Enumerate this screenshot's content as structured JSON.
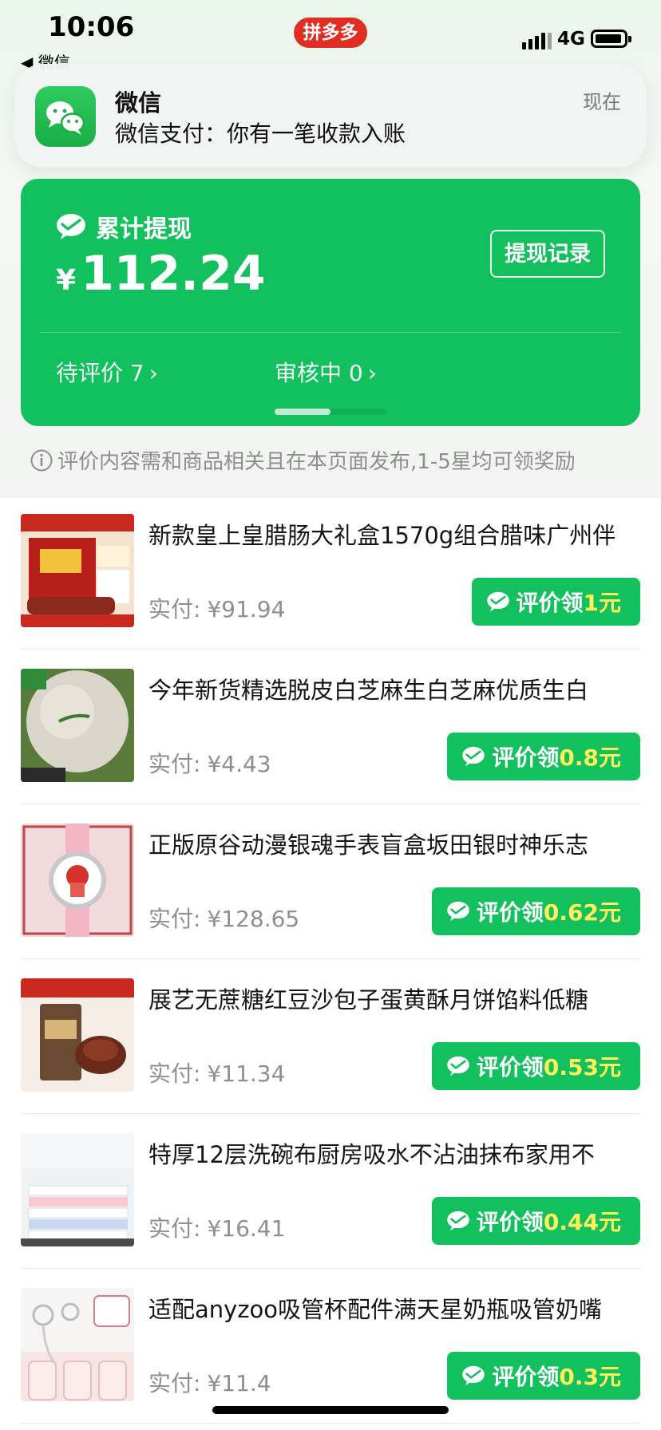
{
  "status_bar": {
    "time": "10:06",
    "back_label": "◀ 微信",
    "app_badge": "拼多多",
    "network": "4G"
  },
  "notification": {
    "app": "微信",
    "message": "微信支付：你有一笔收款入账",
    "time": "现在"
  },
  "summary": {
    "title": "累计提现",
    "currency": "¥",
    "amount": "112.24",
    "withdraw_button": "提现记录",
    "pending_review": "待评价 7",
    "reviewing": "审核中 0",
    "page_indicator": {
      "active_index": 0,
      "total": 2
    }
  },
  "notice": "评价内容需和商品相关且在本页面发布,1-5星均可领奖励",
  "items": [
    {
      "title": "新款皇上皇腊肠大礼盒1570g组合腊味广州伴",
      "price_label": "实付:",
      "price": "¥91.94",
      "button_prefix": "评价领",
      "reward": "1元"
    },
    {
      "title": "今年新货精选脱皮白芝麻生白芝麻优质生白",
      "price_label": "实付:",
      "price": "¥4.43",
      "button_prefix": "评价领",
      "reward": "0.8元"
    },
    {
      "title": "正版原谷动漫银魂手表盲盒坂田银时神乐志",
      "price_label": "实付:",
      "price": "¥128.65",
      "button_prefix": "评价领",
      "reward": "0.62元"
    },
    {
      "title": "展艺无蔗糖红豆沙包子蛋黄酥月饼馅料低糖",
      "price_label": "实付:",
      "price": "¥11.34",
      "button_prefix": "评价领",
      "reward": "0.53元"
    },
    {
      "title": "特厚12层洗碗布厨房吸水不沾油抹布家用不",
      "price_label": "实付:",
      "price": "¥16.41",
      "button_prefix": "评价领",
      "reward": "0.44元"
    },
    {
      "title": "适配anyzoo吸管杯配件满天星奶瓶吸管奶嘴",
      "price_label": "实付:",
      "price": "¥11.4",
      "button_prefix": "评价领",
      "reward": "0.3元"
    }
  ],
  "colors": {
    "brand_green": "#12c05e",
    "reward_yellow": "#fff05a",
    "pdd_red": "#e02e24"
  }
}
